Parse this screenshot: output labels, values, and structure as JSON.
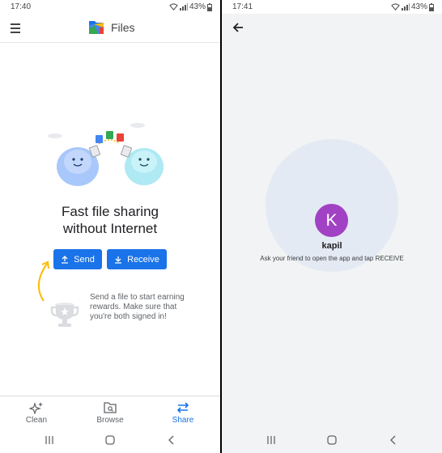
{
  "left": {
    "status": {
      "time": "17:40",
      "battery": "43%"
    },
    "appbar": {
      "title": "Files",
      "menu_icon": "hamburger-icon"
    },
    "headline": {
      "line1": "Fast file sharing",
      "line2": "without Internet"
    },
    "buttons": {
      "send": "Send",
      "receive": "Receive"
    },
    "reward_text": "Send a file to start earning rewards. Make sure that you're both signed in!",
    "bottom_nav": [
      {
        "label": "Clean",
        "icon": "sparkle-icon",
        "active": false
      },
      {
        "label": "Browse",
        "icon": "browse-icon",
        "active": false
      },
      {
        "label": "Share",
        "icon": "share-swap-icon",
        "active": true
      }
    ],
    "accent_color": "#1a73e8"
  },
  "right": {
    "status": {
      "time": "17:41",
      "battery": "43%"
    },
    "avatar_letter": "K",
    "avatar_color": "#a142c4",
    "user_name": "kapil",
    "hint": "Ask your friend to open the app and tap RECEIVE"
  }
}
